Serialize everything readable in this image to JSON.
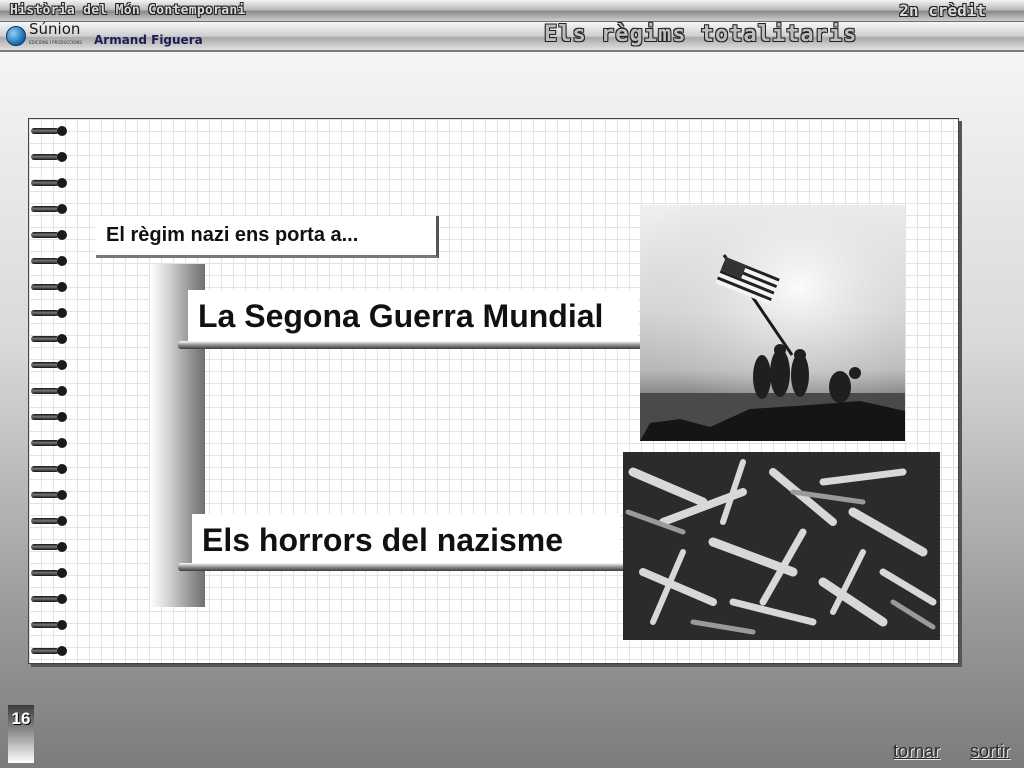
{
  "header": {
    "course_title": "Història del Món Contemporani",
    "credit": "2n crèdit",
    "section_title": "Els règims totalitaris",
    "brand_name": "Súnion",
    "brand_subtitle": "EDICIONS I PRODUCCIONS",
    "author": "Armand Figuera"
  },
  "slide": {
    "intro": "El règim nazi ens porta a...",
    "topics": [
      {
        "label": "La Segona Guerra Mundial",
        "image_icon": "flag-raising-photo"
      },
      {
        "label": "Els horrors del nazisme",
        "image_icon": "concentration-camp-photo"
      }
    ]
  },
  "footer": {
    "page_number": "16",
    "back_label": "tornar",
    "exit_label": "sortir"
  }
}
